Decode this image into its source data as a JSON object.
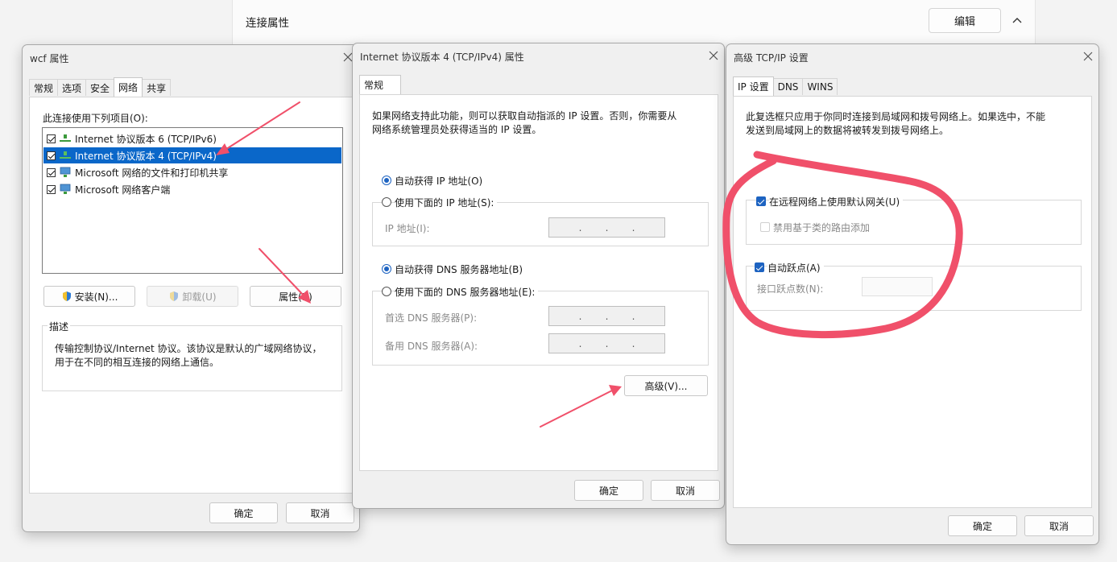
{
  "settings": {
    "section_title": "连接属性",
    "edit_label": "编辑"
  },
  "wcf": {
    "title": "wcf 属性",
    "tabs": [
      "常规",
      "选项",
      "安全",
      "网络",
      "共享"
    ],
    "list_label": "此连接使用下列项目(O):",
    "items": [
      {
        "label": "Internet 协议版本 6 (TCP/IPv6)",
        "checked": true
      },
      {
        "label": "Internet 协议版本 4 (TCP/IPv4)",
        "checked": true
      },
      {
        "label": "Microsoft 网络的文件和打印机共享",
        "checked": true
      },
      {
        "label": "Microsoft 网络客户端",
        "checked": true
      }
    ],
    "install_label": "安装(N)...",
    "uninstall_label": "卸载(U)",
    "properties_label": "属性(R)",
    "desc_title": "描述",
    "desc_line1": "传输控制协议/Internet 协议。该协议是默认的广域网络协议，",
    "desc_line2": "用于在不同的相互连接的网络上通信。",
    "ok_label": "确定",
    "cancel_label": "取消"
  },
  "ipv4": {
    "title": "Internet 协议版本 4 (TCP/IPv4) 属性",
    "tab": "常规",
    "intro_line1": "如果网络支持此功能，则可以获取自动指派的 IP 设置。否则，你需要从",
    "intro_line2": "网络系统管理员处获得适当的 IP 设置。",
    "auto_ip": "自动获得 IP 地址(O)",
    "manual_ip": "使用下面的 IP 地址(S):",
    "ip_label": "IP 地址(I):",
    "auto_dns": "自动获得 DNS 服务器地址(B)",
    "manual_dns": "使用下面的 DNS 服务器地址(E):",
    "preferred_dns": "首选 DNS 服务器(P):",
    "alternate_dns": "备用 DNS 服务器(A):",
    "advanced_label": "高级(V)...",
    "ok_label": "确定",
    "cancel_label": "取消"
  },
  "adv": {
    "title": "高级 TCP/IP 设置",
    "tabs": [
      "IP 设置",
      "DNS",
      "WINS"
    ],
    "info_line1": "此复选框只应用于你同时连接到局域网和拨号网络上。如果选中，不能",
    "info_line2": "发送到局域网上的数据将被转发到拨号网络上。",
    "use_gateway": "在远程网络上使用默认网关(U)",
    "disable_class_routes": "禁用基于类的路由添加",
    "auto_metric": "自动跃点(A)",
    "interface_metric": "接口跃点数(N):",
    "ok_label": "确定",
    "cancel_label": "取消"
  },
  "colors": {
    "selection": "#0a67c9",
    "checkbox": "#1d63c1",
    "annotation": "#f0506a"
  }
}
